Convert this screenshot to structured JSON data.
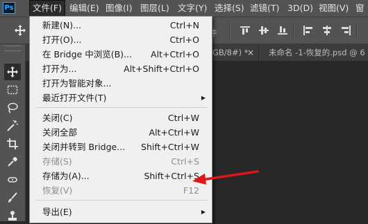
{
  "app": {
    "logo_text": "Ps"
  },
  "menubar": {
    "items": [
      "文件(F)",
      "编辑(E)",
      "图像(I)",
      "图层(L)",
      "文字(Y)",
      "选择(S)",
      "滤镜(T)",
      "3D(D)",
      "视图(V)",
      "窗"
    ]
  },
  "optionsbar": {
    "partial_label": "件"
  },
  "tabs": {
    "partial_info": "GB/8#) *",
    "close_glyph": "×",
    "second_tab": "未命名 -1-恢复的.psd @ 6"
  },
  "file_menu": {
    "items": [
      {
        "label": "新建(N)...",
        "shortcut": "Ctrl+N",
        "disabled": false
      },
      {
        "label": "打开(O)...",
        "shortcut": "Ctrl+O",
        "disabled": false
      },
      {
        "label": "在 Bridge 中浏览(B)...",
        "shortcut": "Alt+Ctrl+O",
        "disabled": false
      },
      {
        "label": "打开为...",
        "shortcut": "Alt+Shift+Ctrl+O",
        "disabled": false
      },
      {
        "label": "打开为智能对象...",
        "shortcut": "",
        "disabled": false
      },
      {
        "label": "最近打开文件(T)",
        "shortcut": "",
        "disabled": false,
        "submenu": true
      },
      {
        "label": "关闭(C)",
        "shortcut": "Ctrl+W",
        "disabled": false
      },
      {
        "label": "关闭全部",
        "shortcut": "Alt+Ctrl+W",
        "disabled": false
      },
      {
        "label": "关闭并转到 Bridge...",
        "shortcut": "Shift+Ctrl+W",
        "disabled": false
      },
      {
        "label": "存储(S)",
        "shortcut": "Ctrl+S",
        "disabled": true
      },
      {
        "label": "存储为(A)...",
        "shortcut": "Shift+Ctrl+S",
        "disabled": false
      },
      {
        "label": "恢复(V)",
        "shortcut": "F12",
        "disabled": true
      },
      {
        "label": "导出(E)",
        "shortcut": "",
        "disabled": false,
        "submenu": true
      }
    ],
    "submenu_glyph": "▶"
  },
  "colors": {
    "menubar_bg": "#535353",
    "workspace_bg": "#282828",
    "menu_bg": "#f0f0f0",
    "annotation_arrow": "#e0141b",
    "ps_accent": "#31a8ff"
  }
}
